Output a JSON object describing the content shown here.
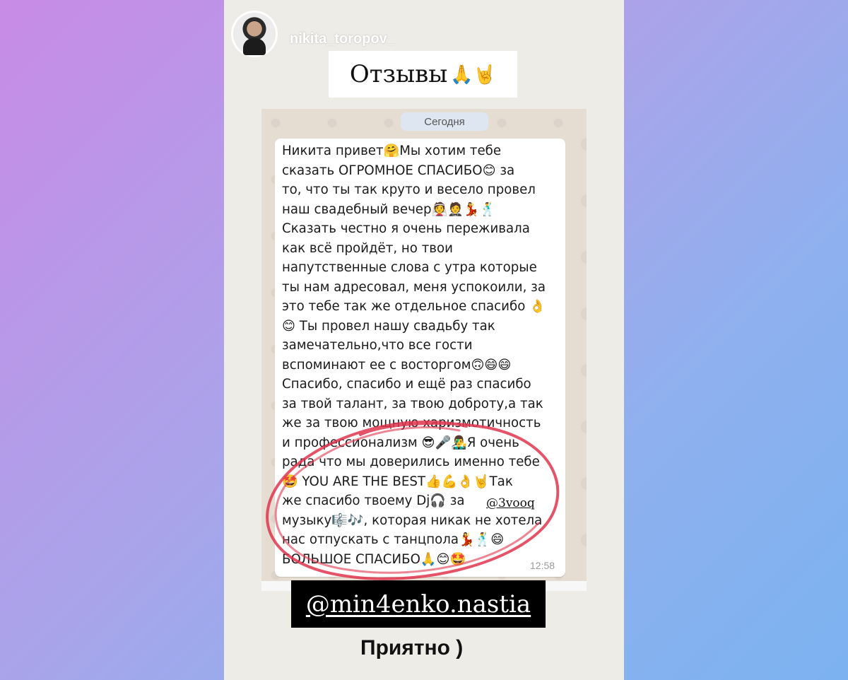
{
  "story": {
    "username": "nikita_toropov_",
    "title": "Отзывы",
    "title_emoji": "🙏🤘",
    "caption": "Приятно  )"
  },
  "chat": {
    "date_label": "Сегодня",
    "message": "Никита привет🤗Мы хотим тебе\nсказать ОГРОМНОЕ СПАСИБО😊 за\nто, что ты так круто и весело провел\nнаш свадебный вечер👰🤵💃🕺\nСказать честно я очень переживала\nкак всё пройдёт, но твои\nнапутственные слова с утра которые\nты нам адресовал, меня успокоили, за\nэто тебе так же отдельное спасибо 👌\n😊 Ты провел нашу свадьбу так\nзамечательно,что все гости\nвспоминают ее с восторгом🙃😄😄\nСпасибо, спасибо и ещё раз спасибо\nза твой талант, за твою доброту,а так\nже за твою мощную харизмотичность\nи профессионализм 😎🎤👨‍🎤Я очень\nрада что мы доверились именно тебе\n🤩 YOU ARE THE BEST👍💪👌🤘Так\nже спасибо твоему Dj🎧 за\nмузыку🎼🎶, которая никак не хотела\nнас отпускать с танцпола💃🕺😄\nБОЛЬШОЕ СПАСИБО🙏😊🤩",
    "time": "12:58",
    "inline_mention": "@3vooq"
  },
  "mention": "@min4enko.nastia",
  "colors": {
    "highlight_circle": "#e0354f",
    "story_bg": "#eeece7",
    "chat_bg": "#e5ddd2"
  }
}
